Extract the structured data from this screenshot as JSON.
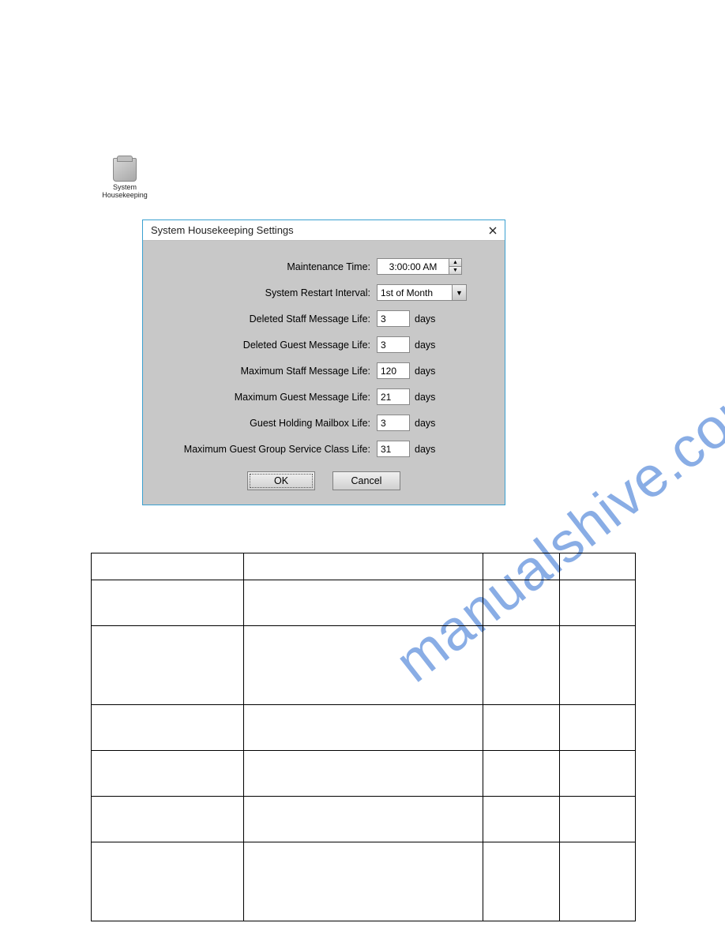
{
  "desktop_icon": {
    "label": "System Housekeeping"
  },
  "dialog": {
    "title": "System Housekeeping Settings",
    "fields": {
      "maintenance_time": {
        "label": "Maintenance Time:",
        "value": "3:00:00 AM"
      },
      "restart_interval": {
        "label": "System Restart Interval:",
        "value": "1st of Month"
      },
      "deleted_staff": {
        "label": "Deleted Staff Message Life:",
        "value": "3",
        "unit": "days"
      },
      "deleted_guest": {
        "label": "Deleted Guest Message Life:",
        "value": "3",
        "unit": "days"
      },
      "max_staff": {
        "label": "Maximum Staff Message Life:",
        "value": "120",
        "unit": "days"
      },
      "max_guest": {
        "label": "Maximum Guest Message Life:",
        "value": "21",
        "unit": "days"
      },
      "holding_mailbox": {
        "label": "Guest Holding Mailbox Life:",
        "value": "3",
        "unit": "days"
      },
      "group_service": {
        "label": "Maximum Guest Group Service Class Life:",
        "value": "31",
        "unit": "days"
      }
    },
    "buttons": {
      "ok": "OK",
      "cancel": "Cancel"
    }
  },
  "watermark": "manualshive.com"
}
